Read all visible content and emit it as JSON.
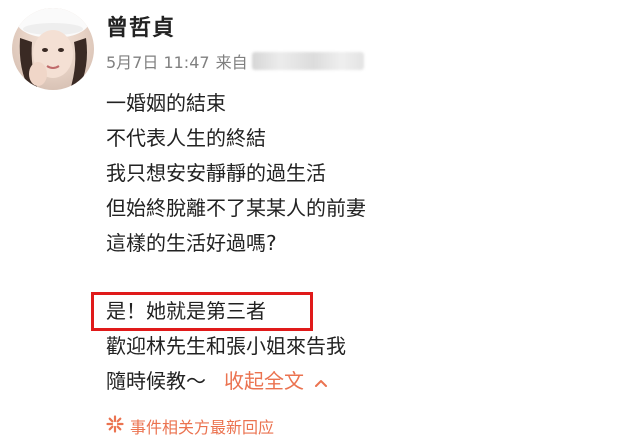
{
  "post": {
    "author": "曾哲貞",
    "date": "5月7日 11:47",
    "source_label": "来自",
    "lines": [
      "一婚姻的結束",
      "不代表人生的終結",
      "我只想安安靜靜的過生活",
      "但始終脫離不了某某人的前妻",
      "這樣的生活好過嗎?"
    ],
    "highlighted_line": "是！她就是第三者",
    "after_lines": [
      "歡迎林先生和張小姐來告我"
    ],
    "last_line": "隨時候教～",
    "collapse_label": "收起全文",
    "related_label": "事件相关方最新回应"
  },
  "icons": {
    "avatar": "avatar-photo",
    "collapse": "chevron-up-icon",
    "related": "burst-icon"
  },
  "colors": {
    "accent": "#eb7350",
    "highlight_border": "#e01a1a",
    "meta_text": "#808080"
  }
}
